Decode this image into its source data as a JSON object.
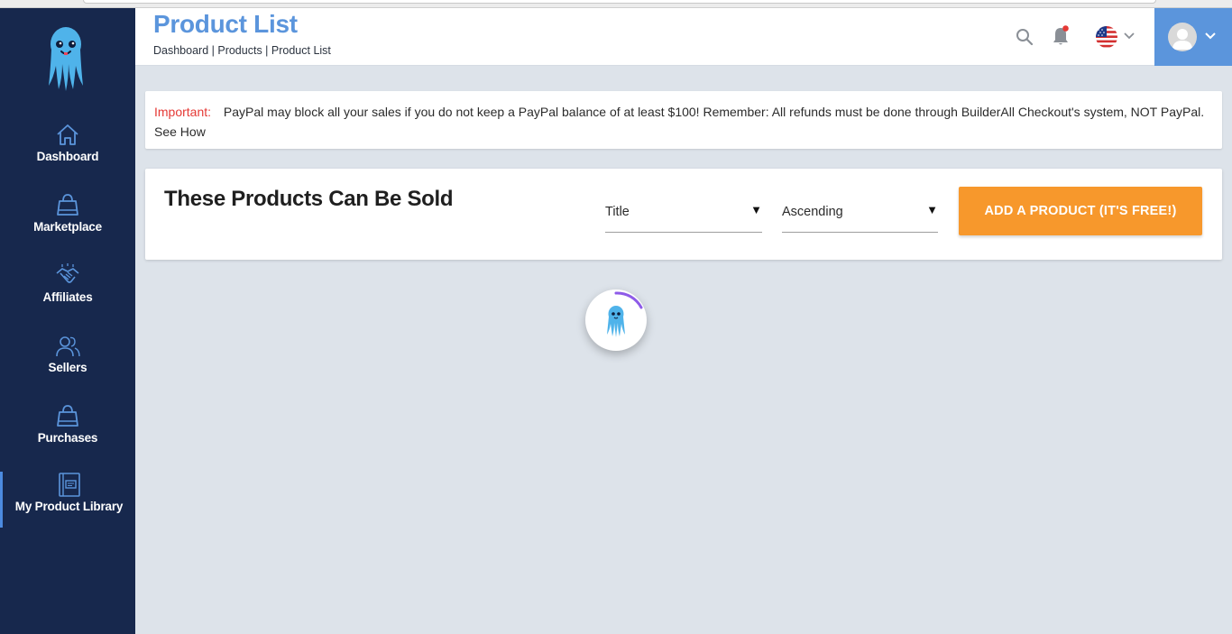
{
  "sidebar": {
    "items": [
      {
        "label": "Dashboard",
        "icon": "home-icon"
      },
      {
        "label": "Marketplace",
        "icon": "shopping-bag-icon"
      },
      {
        "label": "Affiliates",
        "icon": "handshake-icon"
      },
      {
        "label": "Sellers",
        "icon": "users-icon"
      },
      {
        "label": "Purchases",
        "icon": "shopping-bag-icon"
      },
      {
        "label": "My Product Library",
        "icon": "library-icon",
        "active": true
      }
    ]
  },
  "header": {
    "title": "Product List",
    "breadcrumb": [
      "Dashboard",
      "Products",
      "Product List"
    ],
    "breadcrumb_separator": " | "
  },
  "alert": {
    "label": "Important:",
    "message": "PayPal may block all your sales if you do not keep a PayPal balance of at least $100! Remember: All refunds must be done through BuilderAll Checkout's system, NOT PayPal. See How"
  },
  "products": {
    "heading": "These Products Can Be Sold",
    "sort_field": "Title",
    "sort_order": "Ascending",
    "add_button": "ADD A PRODUCT (IT'S FREE!)"
  },
  "colors": {
    "sidebar_bg": "#17284d",
    "accent_blue": "#5b95dc",
    "button_orange": "#f7982c",
    "important_red": "#e53935",
    "page_bg": "#dde3ea"
  }
}
